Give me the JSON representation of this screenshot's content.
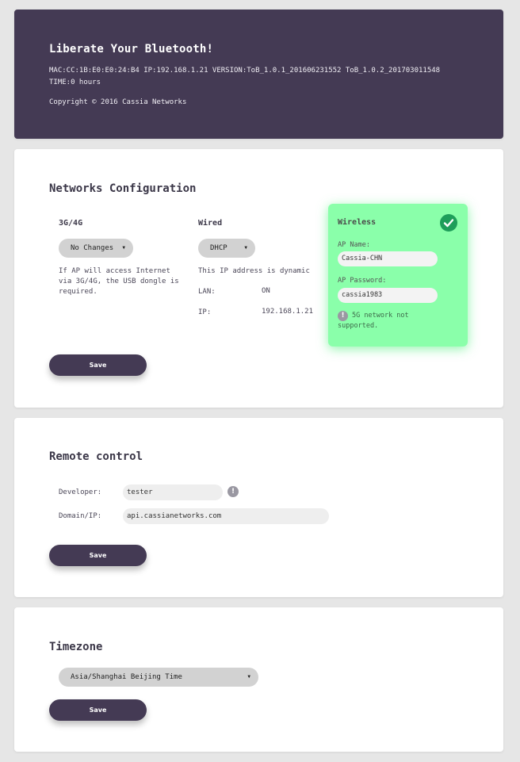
{
  "header": {
    "title": "Liberate Your Bluetooth!",
    "info_line": "MAC:CC:1B:E0:E0:24:B4 IP:192.168.1.21 VERSION:ToB_1.0.1_201606231552 ToB_1.0.2_201703011548",
    "time_line": "TIME:0 hours",
    "copyright": "Copyright © 2016 Cassia Networks"
  },
  "networks": {
    "title": "Networks Configuration",
    "cellular": {
      "title": "3G/4G",
      "select_value": "No Changes",
      "note": "If AP will access Internet via 3G/4G, the USB dongle is required."
    },
    "wired": {
      "title": "Wired",
      "select_value": "DHCP",
      "note": "This IP address is dynamic",
      "lan_label": "LAN:",
      "lan_value": "ON",
      "ip_label": "IP:",
      "ip_value": "192.168.1.21"
    },
    "wireless": {
      "title": "Wireless",
      "ap_name_label": "AP Name:",
      "ap_name_value": "Cassia-CHN",
      "ap_password_label": "AP Password:",
      "ap_password_value": "cassia1983",
      "warning": "5G network not supported."
    },
    "save_label": "Save"
  },
  "remote": {
    "title": "Remote control",
    "developer_label": "Developer:",
    "developer_value": "tester",
    "domain_label": "Domain/IP:",
    "domain_value": "api.cassianetworks.com",
    "save_label": "Save"
  },
  "timezone": {
    "title": "Timezone",
    "select_value": "Asia/Shanghai Beijing Time",
    "save_label": "Save"
  },
  "colors": {
    "header_bg": "#443a54",
    "button_bg": "#443a54",
    "wireless_bg": "#8affaa",
    "check_green": "#1e9e5a",
    "page_bg": "#e6e6e6"
  },
  "icons": {
    "select_arrow": "triangle-down",
    "wireless_status": "check-circle-icon",
    "info": "info-icon"
  }
}
